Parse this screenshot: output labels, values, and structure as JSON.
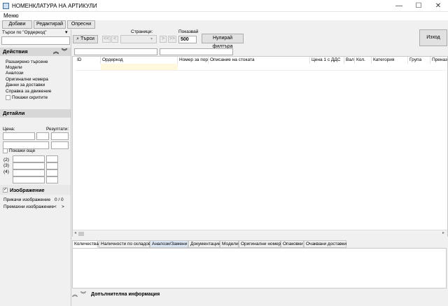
{
  "window": {
    "title": "НОМЕНКЛАТУРА НА АРТИКУЛИ",
    "minimize": "—",
    "maximize": "☐",
    "close": "✕"
  },
  "menu": {
    "label": "Меню"
  },
  "toolbar": {
    "add": "Добави",
    "edit": "Редактирай",
    "refresh": "Опресни"
  },
  "search": {
    "label": "Търси по \"Ордеркод\"",
    "value": "",
    "button": "Търси"
  },
  "pager": {
    "first": "<<",
    "prev": "<",
    "pages_label": "Страници:",
    "page_value": "",
    "next": ">",
    "last": ">>",
    "show_label": "Показвай",
    "show_value": "500",
    "reset_filter": "Нулирай филтъра",
    "exit": "Изход"
  },
  "actions": {
    "title": "Действия",
    "items": [
      "Разширено търсене",
      "Модели",
      "Аналози",
      "Оригинални номера",
      "Данни за доставки",
      "Справка за движение"
    ],
    "show_hidden": "Покажи скритите"
  },
  "details": {
    "title": "Детайли",
    "price_label": "Цена:",
    "results_label": "Резултати:",
    "show_more": "Покажи още",
    "rows": [
      "(2)",
      "(3)",
      "(4)"
    ]
  },
  "image": {
    "title": "Изображение",
    "attached_label": "Прикачи изображение",
    "attached_count": "0 / 0",
    "remove_label": "Премахни изображение",
    "prev": "<",
    "next": ">"
  },
  "grid": {
    "columns": [
      "ID",
      "Ордеркод",
      "Номер за поръч",
      "Описание на стоката",
      "Цена 1 с ДДС",
      "Вал.",
      "Кол.",
      "Категория",
      "Група",
      "Преназ"
    ]
  },
  "bottom_tabs": [
    "Количества",
    "Наличности по складове",
    "Аналози/Замени",
    "Документации",
    "Модели",
    "Оригинални номера",
    "Опаковки",
    "Очаквани доставки"
  ],
  "footer": {
    "label": "Допълнителна информация"
  }
}
